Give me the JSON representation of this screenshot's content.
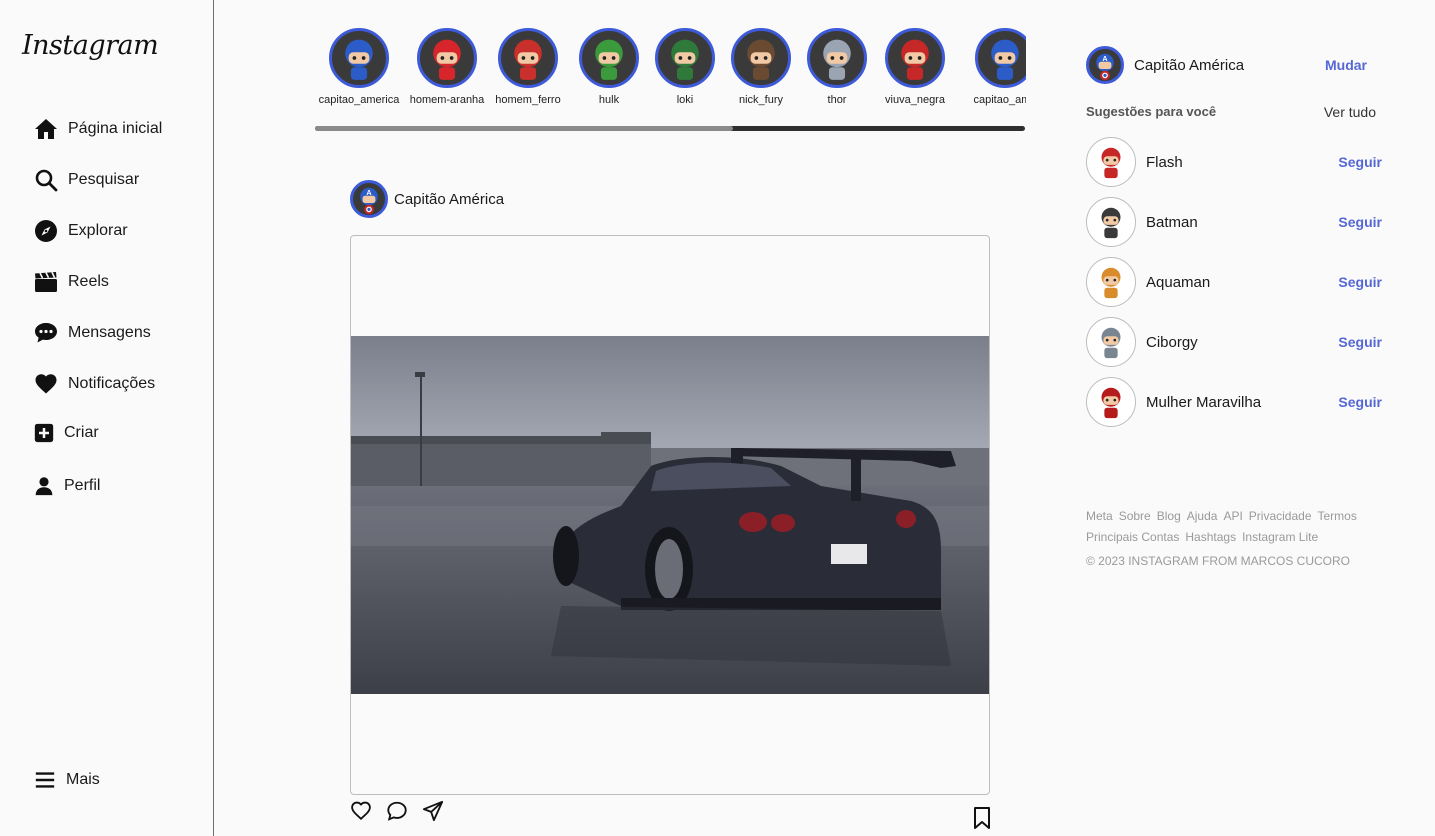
{
  "sidebar": {
    "logo": "Instagram",
    "items": [
      {
        "label": "Página inicial",
        "icon": "home-icon"
      },
      {
        "label": "Pesquisar",
        "icon": "search-icon"
      },
      {
        "label": "Explorar",
        "icon": "compass-icon"
      },
      {
        "label": "Reels",
        "icon": "clapperboard-icon"
      },
      {
        "label": "Mensagens",
        "icon": "chat-bubble-icon"
      },
      {
        "label": "Notificações",
        "icon": "heart-icon"
      },
      {
        "label": "Criar",
        "icon": "plus-square-icon"
      },
      {
        "label": "Perfil",
        "icon": "user-icon"
      }
    ],
    "more_label": "Mais"
  },
  "stories": [
    {
      "label": "capitao_america",
      "color": "#2b5cc8"
    },
    {
      "label": "homem-aranha",
      "color": "#d6262b"
    },
    {
      "label": "homem_ferro",
      "color": "#c9302c"
    },
    {
      "label": "hulk",
      "color": "#3b9a3b"
    },
    {
      "label": "loki",
      "color": "#2f7a3a"
    },
    {
      "label": "nick_fury",
      "color": "#6b4a32"
    },
    {
      "label": "thor",
      "color": "#9aa4b2"
    },
    {
      "label": "viuva_negra",
      "color": "#c62828"
    },
    {
      "label": "capitao_ame",
      "color": "#2b5cc8"
    }
  ],
  "post": {
    "author": "Capitão América"
  },
  "profile": {
    "name": "Capitão América",
    "switch_label": "Mudar"
  },
  "suggestions": {
    "title": "Sugestões para você",
    "see_all": "Ver tudo",
    "follow_label": "Seguir",
    "items": [
      {
        "name": "Flash",
        "color": "#c62828"
      },
      {
        "name": "Batman",
        "color": "#3a3a3a"
      },
      {
        "name": "Aquaman",
        "color": "#d98c2b"
      },
      {
        "name": "Ciborgy",
        "color": "#7a8592"
      },
      {
        "name": "Mulher Maravilha",
        "color": "#b71c1c"
      }
    ]
  },
  "footer": {
    "links_row1": [
      "Meta",
      "Sobre",
      "Blog",
      "Ajuda",
      "API",
      "Privacidade",
      "Termos"
    ],
    "links_row2": [
      "Principais Contas",
      "Hashtags",
      "Instagram Lite"
    ],
    "copyright": "© 2023 INSTAGRAM FROM MARCOS CUCORO"
  },
  "colors": {
    "accent": "#5668d3",
    "story_ring": "#3d5ad8"
  }
}
